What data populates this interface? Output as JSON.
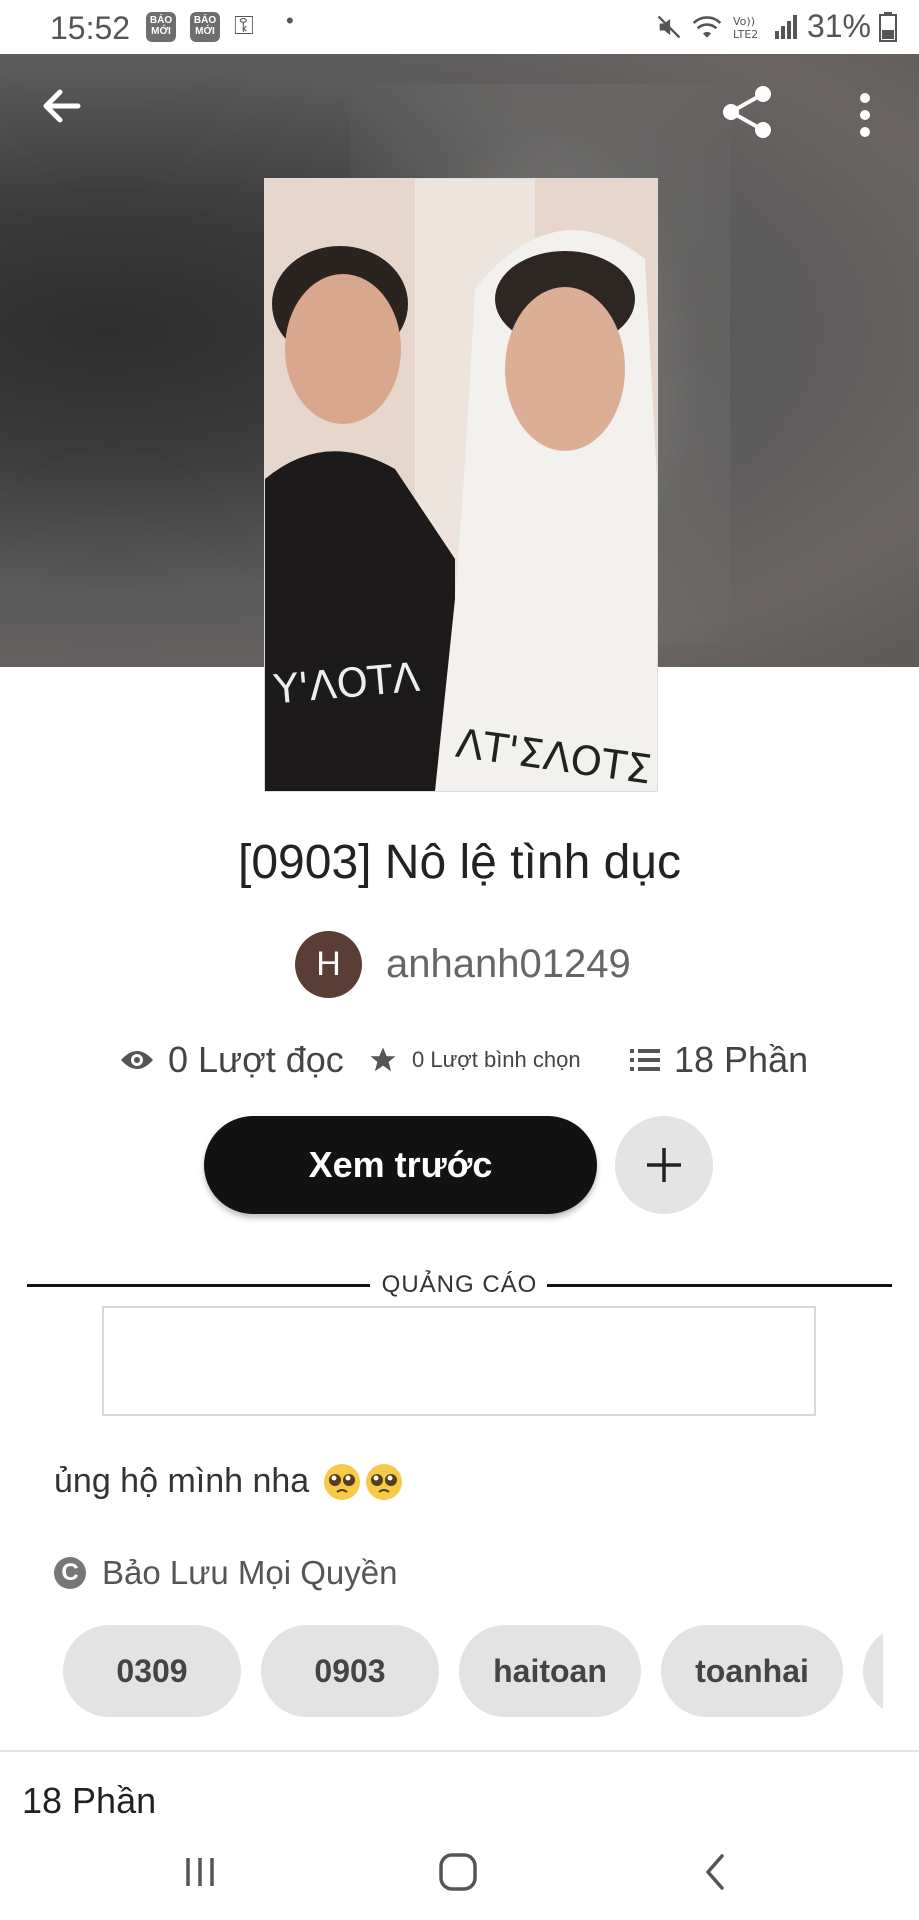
{
  "status_bar": {
    "time": "15:52",
    "badge_1": "BÁO MỚI",
    "badge_2": "BÁO MỚI",
    "battery": "31%",
    "icons": [
      "key-icon",
      "mute-icon",
      "wifi-icon",
      "volte-icon",
      "signal-icon",
      "battery-icon"
    ]
  },
  "toolbar": {
    "back_icon": "arrow-left-icon",
    "share_icon": "share-icon",
    "more_icon": "more-vertical-icon"
  },
  "story": {
    "title": "[0903]  Nô lệ tình dục",
    "author_initial": "H",
    "author": "anhanh01249",
    "reads": "0 Lượt đọc",
    "votes": "0 Lượt bình chọn",
    "parts": "18 Phần",
    "description": "ủng hộ mình nha",
    "copyright": "Bảo Lưu Mọi Quyền"
  },
  "actions": {
    "read_label": "Xem trước",
    "add_icon": "plus-icon"
  },
  "ad": {
    "label": "QUẢNG CÁO"
  },
  "tags": [
    "0309",
    "0903",
    "haitoan",
    "toanhai",
    ""
  ],
  "parts_section": {
    "heading": "18 Phần"
  },
  "navbar": {
    "icons": [
      "recent-apps-icon",
      "home-icon",
      "back-icon"
    ]
  },
  "colors": {
    "primary_button": "#121212",
    "avatar_bg": "#5a3e36",
    "tag_bg": "#e3e3e3"
  }
}
